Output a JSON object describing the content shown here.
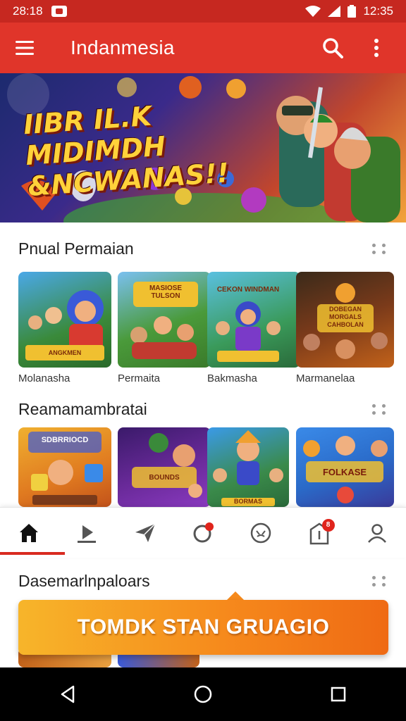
{
  "status_bar": {
    "time_left": "28:18",
    "time_right": "12:35"
  },
  "app_bar": {
    "title": "Indanmesia",
    "icons": [
      "menu-icon",
      "search-icon",
      "more-vert-icon"
    ]
  },
  "banner": {
    "headline_line1": "IIBR IL.K MIDIMDH",
    "headline_line2": "&NCWANAS!!"
  },
  "sections": [
    {
      "title": "Pnual Permaian",
      "items": [
        "Molanasha",
        "Permaita",
        "Bakmasha",
        "Marmanelaa"
      ]
    },
    {
      "title": "Reamamambratai",
      "items": [
        "",
        "",
        "",
        ""
      ]
    },
    {
      "title": "Dasemarlnpaloars"
    }
  ],
  "tile_captions": {
    "row1": [
      "ANGKMEN",
      "MASIOSE TULSON",
      "CEKON WINDMAN",
      "DOBEGAN MORGALS CAHBOLAN"
    ],
    "row2": [
      "SDBRRIOCD",
      "BOUNDS",
      "BORMAS",
      "FOLKASE"
    ]
  },
  "bottom_nav": {
    "items": [
      "home-icon",
      "download-icon",
      "send-icon",
      "notifications-icon",
      "emoji-icon",
      "inbox-icon",
      "profile-icon"
    ],
    "badge_count": "8"
  },
  "cta": {
    "label": "TOMDK STAN GRUAGIO"
  },
  "colors": {
    "primary": "#e0352a",
    "status": "#c62820",
    "accent": "#f68a1c"
  }
}
